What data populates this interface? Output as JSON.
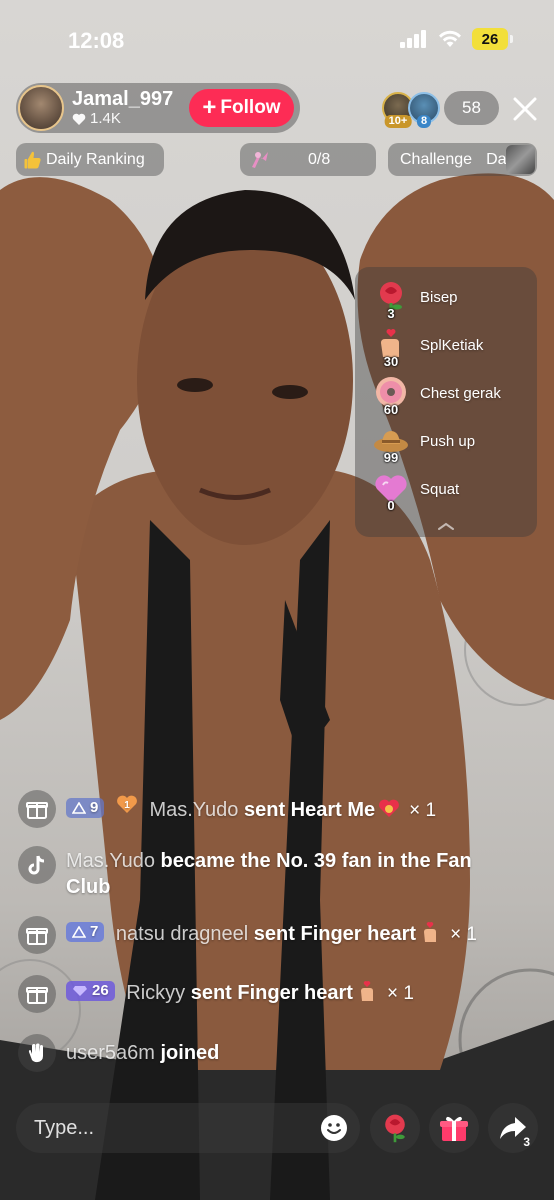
{
  "status_bar": {
    "time": "12:08",
    "battery": "26"
  },
  "host": {
    "name": "Jamal_997",
    "likes": "1.4K",
    "follow_label": "Follow"
  },
  "viewers": {
    "badge_1": "10+",
    "badge_2": "8",
    "count": "58"
  },
  "chips": {
    "ranking": "Daily Ranking",
    "goal_progress": "0/8",
    "challenge": "Challenge",
    "challenge_suffix": "Da"
  },
  "gift_menu": {
    "items": [
      {
        "label": "Bisep",
        "count": "3",
        "icon": "rose-icon"
      },
      {
        "label": "SplKetiak",
        "count": "30",
        "icon": "finger-heart-icon"
      },
      {
        "label": "Chest gerak",
        "count": "60",
        "icon": "donut-icon"
      },
      {
        "label": "Push up",
        "count": "99",
        "icon": "cowboy-hat-icon"
      },
      {
        "label": "Squat",
        "count": "0",
        "icon": "heart-icon"
      }
    ]
  },
  "chat": [
    {
      "type": "gift",
      "level": "9",
      "fan_level": "1",
      "user": "Mas.Yudo",
      "text": "sent Heart Me",
      "multiplier": "× 1"
    },
    {
      "type": "fan",
      "user": "Mas.Yudo",
      "text": "became the No. 39 fan in the Fan Club"
    },
    {
      "type": "gift",
      "level": "7",
      "user": "natsu dragneel",
      "text": "sent Finger heart",
      "multiplier": "× 1"
    },
    {
      "type": "gift",
      "level": "26",
      "user": "Rickyy",
      "text": "sent Finger heart",
      "multiplier": "× 1"
    },
    {
      "type": "join",
      "user": "user5a6m",
      "text": "joined"
    }
  ],
  "bottom": {
    "placeholder": "Type...",
    "share_count": "3"
  },
  "colors": {
    "follow": "#fd2c55",
    "battery": "#f2df3a"
  }
}
